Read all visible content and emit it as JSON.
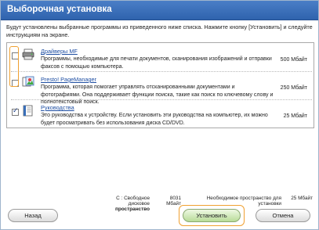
{
  "window": {
    "title": "Выборочная установка"
  },
  "instruction": "Будут установлены выбранные программы из приведенного ниже списка. Нажмите кнопку [Установить] и следуйте инструкциям на экране.",
  "components": [
    {
      "name": "Драйверы MF",
      "description": "Программы, необходимые для печати документов, сканирования изображений и отправки факсов с помощью компьютера.",
      "size": "500 Мбайт",
      "checked": false,
      "icon": "printer-icon"
    },
    {
      "name": "Presto! PageManager",
      "description": "Программа, которая помогает управлять отсканированными документами и фотографиями. Она поддерживает функции поиска, такие как поиск по ключевому слову и полнотекстовый поиск.",
      "size": "250 Мбайт",
      "checked": false,
      "icon": "pagemanager-icon"
    },
    {
      "name": "Руководства",
      "description": "Это руководства к устройству. Если установить эти руководства на компьютер, их можно будет просматривать без использования диска CD/DVD.",
      "size": "25 Мбайт",
      "checked": true,
      "icon": "manual-icon"
    }
  ],
  "status": {
    "free_label_1": "С : Свободное дисковое",
    "free_label_2": "пространство",
    "free_value": "8031 Мбайт",
    "required_label_1": "Необходимое пространство для",
    "required_label_2": "установки",
    "required_value": "25 Мбайт"
  },
  "buttons": {
    "back": "Назад",
    "install": "Установить",
    "cancel": "Отмена"
  },
  "colors": {
    "title_bar": "#3a6fb8",
    "highlight": "#f0a030",
    "link": "#1f4fa3"
  }
}
